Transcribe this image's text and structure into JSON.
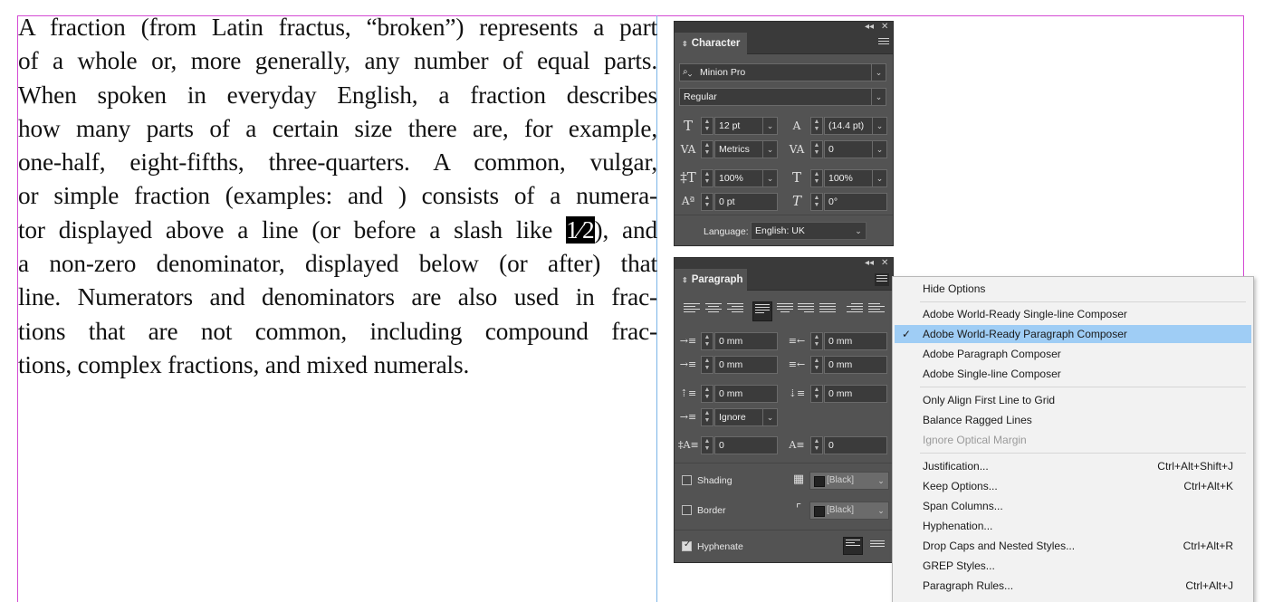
{
  "document": {
    "lines": [
      "A fraction (from Latin fractus, “broken”) represents a part",
      "of a whole or, more generally, any number of equal parts.",
      "When spoken in everyday English, a fraction describes",
      "how many parts of a certain size there are, for example,",
      "one-half, eight-fifths, three-quarters. A common, vulgar,",
      "or simple fraction (examples: and ) consists of a numera-",
      "tor displayed above a line (or before a slash like ",
      "a non-zero denominator, displayed below (or after) that",
      "line. Numerators and denominators are also used in frac-",
      "tions that are not common, including compound frac-",
      "tions, complex fractions, and mixed numerals."
    ],
    "selected_text": "1⁄2",
    "after_selection": "), and"
  },
  "character_panel": {
    "title": "Character",
    "font_family": "Minion Pro",
    "font_style": "Regular",
    "font_size": "12 pt",
    "leading": "(14.4 pt)",
    "kerning": "Metrics",
    "tracking": "0",
    "vertical_scale": "100%",
    "horizontal_scale": "100%",
    "baseline_shift": "0 pt",
    "skew": "0°",
    "language_label": "Language:",
    "language": "English: UK"
  },
  "paragraph_panel": {
    "title": "Paragraph",
    "left_indent": "0 mm",
    "right_indent": "0 mm",
    "first_line_indent": "0 mm",
    "last_line_right_indent": "0 mm",
    "space_before": "0 mm",
    "space_after": "0 mm",
    "align_to_grid": "Ignore",
    "drop_cap_lines": "0",
    "drop_cap_chars": "0",
    "shading_label": "Shading",
    "shading_color": "[Black]",
    "border_label": "Border",
    "border_color": "[Black]",
    "hyphenate_label": "Hyphenate",
    "hyphenate_checked": true
  },
  "context_menu": {
    "items": [
      {
        "label": "Hide Options",
        "shortcut": ""
      },
      {
        "label": "Adobe World-Ready Single-line Composer",
        "shortcut": ""
      },
      {
        "label": "Adobe World-Ready Paragraph Composer",
        "shortcut": "",
        "checked": true
      },
      {
        "label": "Adobe Paragraph Composer",
        "shortcut": ""
      },
      {
        "label": "Adobe Single-line Composer",
        "shortcut": ""
      },
      {
        "label": "Only Align First Line to Grid",
        "shortcut": ""
      },
      {
        "label": "Balance Ragged Lines",
        "shortcut": ""
      },
      {
        "label": "Ignore Optical Margin",
        "shortcut": "",
        "disabled": true
      },
      {
        "label": "Justification...",
        "shortcut": "Ctrl+Alt+Shift+J"
      },
      {
        "label": "Keep Options...",
        "shortcut": "Ctrl+Alt+K"
      },
      {
        "label": "Span Columns...",
        "shortcut": ""
      },
      {
        "label": "Hyphenation...",
        "shortcut": ""
      },
      {
        "label": "Drop Caps and Nested Styles...",
        "shortcut": "Ctrl+Alt+R"
      },
      {
        "label": "GREP Styles...",
        "shortcut": ""
      },
      {
        "label": "Paragraph Rules...",
        "shortcut": "Ctrl+Alt+J"
      }
    ],
    "highlight_color": "#9fcdf5"
  },
  "icons": [
    "search-icon",
    "font-size-icon",
    "leading-icon",
    "kerning-icon",
    "tracking-icon",
    "vertical-scale-icon",
    "horizontal-scale-icon",
    "baseline-shift-icon",
    "skew-icon",
    "checkmark-icon",
    "panel-menu-icon",
    "collapse-icon",
    "close-icon"
  ]
}
